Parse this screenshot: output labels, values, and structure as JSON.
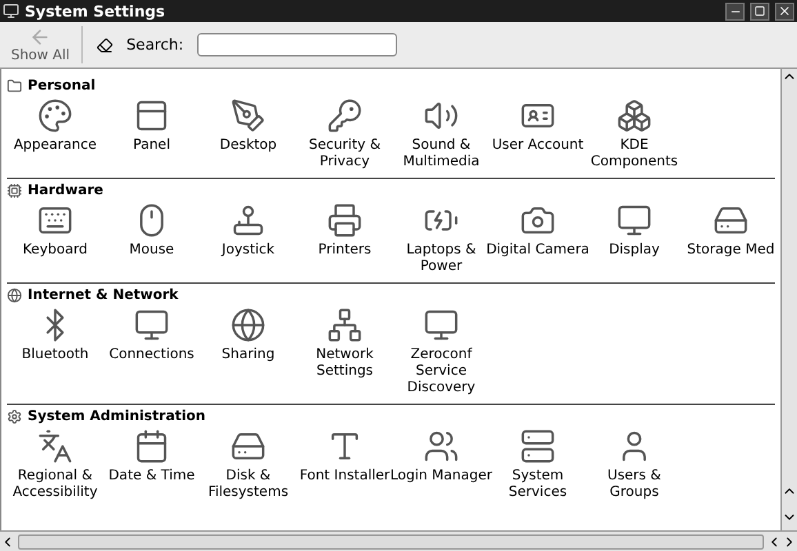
{
  "window": {
    "title": "System Settings"
  },
  "toolbar": {
    "show_all": "Show All",
    "search_label": "Search:"
  },
  "sections": [
    {
      "title": "Personal",
      "items": [
        "Appearance",
        "Panel",
        "Desktop",
        "Security &\nPrivacy",
        "Sound &\nMultimedia",
        "User Account",
        "KDE\nComponents"
      ]
    },
    {
      "title": "Hardware",
      "items": [
        "Keyboard",
        "Mouse",
        "Joystick",
        "Printers",
        "Laptops &\nPower",
        "Digital Camera",
        "Display",
        "Storage Med"
      ]
    },
    {
      "title": "Internet & Network",
      "items": [
        "Bluetooth",
        "Connections",
        "Sharing",
        "Network\nSettings",
        "Zeroconf\nService\nDiscovery"
      ]
    },
    {
      "title": "System Administration",
      "items": [
        "Regional &\nAccessibility",
        "Date & Time",
        "Disk &\nFilesystems",
        "Font Installer",
        "Login Manager",
        "System\nServices",
        "Users &\nGroups"
      ]
    }
  ]
}
